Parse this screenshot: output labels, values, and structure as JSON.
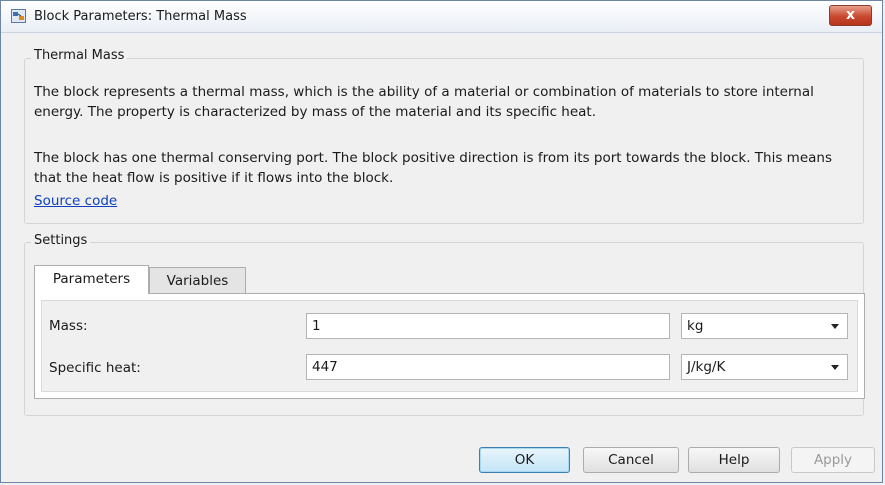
{
  "window": {
    "title": "Block Parameters: Thermal Mass",
    "close_label": "x"
  },
  "description_group": {
    "legend": "Thermal Mass",
    "paragraph1": "The block represents a thermal mass, which is the ability of a material or combination of materials to store internal energy. The property is characterized by mass of the material and its specific heat.",
    "paragraph2": "The block has one thermal conserving port. The block positive direction is from its port towards the block. This means that the heat flow is positive if it flows into the block.",
    "source_link": "Source code"
  },
  "settings": {
    "legend": "Settings",
    "tabs": [
      {
        "label": "Parameters",
        "active": true
      },
      {
        "label": "Variables",
        "active": false
      }
    ],
    "params": [
      {
        "label": "Mass:",
        "value": "1",
        "unit": "kg"
      },
      {
        "label": "Specific heat:",
        "value": "447",
        "unit": "J/kg/K"
      }
    ]
  },
  "buttons": {
    "ok": "OK",
    "cancel": "Cancel",
    "help": "Help",
    "apply": "Apply"
  }
}
